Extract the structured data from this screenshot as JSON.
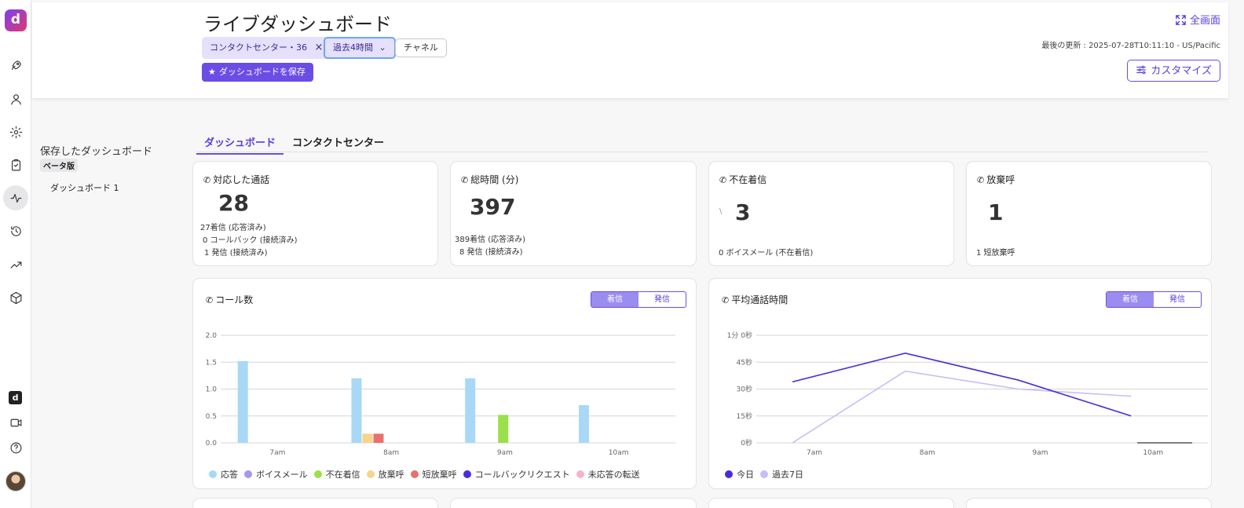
{
  "rail": {
    "logo_letter": "d",
    "icons": [
      "rocket-icon",
      "user-icon",
      "gear-icon",
      "clipboard-icon",
      "activity-icon",
      "history-icon",
      "trending-up-icon",
      "cube-icon",
      "dialpad-logo-icon",
      "video-icon",
      "help-icon"
    ],
    "small_logo_letter": "d"
  },
  "header": {
    "title": "ライブダッシュボード",
    "filter_center": "コンタクトセンター・36",
    "filter_center_close": "×",
    "filter_time": "過去4時間",
    "filter_time_chevron": "⌄",
    "filter_channel": "チャネル",
    "save_label": "ダッシュボードを保存",
    "save_star": "★",
    "fullscreen_label": "全画面",
    "last_updated": "最後の更新 : 2025-07-28T10:11:10 - US/Pacific",
    "customize_label": "カスタマイズ"
  },
  "saved": {
    "title": "保存したダッシュボード",
    "beta": "ベータ版",
    "items": [
      "ダッシュボード 1"
    ]
  },
  "tabs": {
    "dashboard": "ダッシュボード",
    "contact_center": "コンタクトセンター"
  },
  "stats": {
    "handled": {
      "title": "対応した通話",
      "value": "28",
      "lines": [
        "27着信 (応答済み)",
        "0 コールバック (接続済み)",
        "1 発信 (接続済み)"
      ]
    },
    "total_time": {
      "title": "総時間 (分)",
      "value": "397",
      "lines": [
        "389着信 (応答済み)",
        "8  発信 (接続済み)"
      ]
    },
    "missed": {
      "title": "不在着信",
      "value": "3",
      "marker": "\\",
      "lines": [
        "0 ボイスメール (不在着信)"
      ]
    },
    "abandoned": {
      "title": "放棄呼",
      "value": "1",
      "lines": [
        "1  短放棄呼"
      ]
    }
  },
  "call_count": {
    "title": "コール数",
    "toggle": [
      "着信",
      "発信"
    ],
    "legend": [
      {
        "name": "応答",
        "color": "#a9d8f7"
      },
      {
        "name": "ボイスメール",
        "color": "#a895f0"
      },
      {
        "name": "不在着信",
        "color": "#9be04a"
      },
      {
        "name": "放棄呼",
        "color": "#f6d48a"
      },
      {
        "name": "短放棄呼",
        "color": "#ea6f6f"
      },
      {
        "name": "コールバックリクエスト",
        "color": "#4b2bd9"
      },
      {
        "name": "未応答の転送",
        "color": "#f7b3cc"
      }
    ]
  },
  "avg_time": {
    "title": "平均通話時間",
    "toggle": [
      "着信",
      "発信"
    ],
    "legend": [
      {
        "name": "今日",
        "color": "#4b2bd9"
      },
      {
        "name": "過去7日",
        "color": "#c9bdf6"
      }
    ]
  },
  "chart_data": [
    {
      "type": "bar",
      "title": "",
      "categories": [
        "7am",
        "8am",
        "9am",
        "10am"
      ],
      "y_ticks": [
        "0.0",
        "0.5",
        "1.0",
        "1.5",
        "2.0"
      ],
      "ylim": [
        0,
        2.0
      ],
      "series": [
        {
          "name": "応答",
          "values": [
            1.52,
            1.2,
            1.2,
            0.7
          ]
        },
        {
          "name": "放棄呼",
          "values": [
            0,
            0.17,
            0,
            0
          ]
        },
        {
          "name": "短放棄呼",
          "values": [
            0,
            0.17,
            0,
            0
          ]
        },
        {
          "name": "不在着信",
          "values": [
            0,
            0,
            0.52,
            0
          ]
        }
      ]
    },
    {
      "type": "line",
      "title": "",
      "categories": [
        "7am",
        "8am",
        "9am",
        "10am"
      ],
      "y_ticks": [
        "0秒",
        "15秒",
        "30秒",
        "45秒",
        "1分 0秒"
      ],
      "ylim": [
        0,
        60
      ],
      "series": [
        {
          "name": "今日",
          "values": [
            34,
            50,
            35,
            15
          ]
        },
        {
          "name": "過去7日",
          "values": [
            0,
            40,
            30,
            26
          ]
        }
      ]
    }
  ]
}
